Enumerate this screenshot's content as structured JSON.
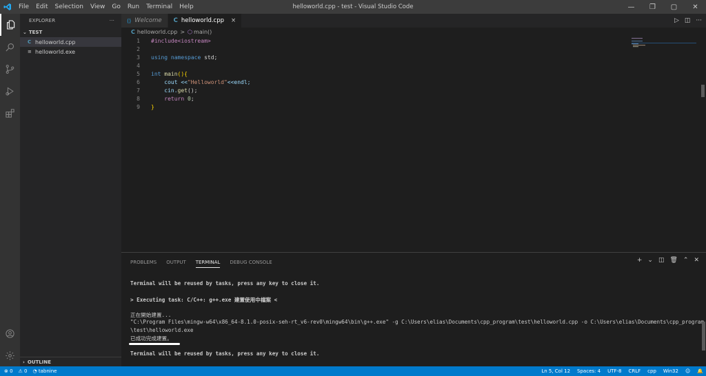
{
  "window": {
    "title": "helloworld.cpp - test - Visual Studio Code",
    "menu": [
      "File",
      "Edit",
      "Selection",
      "View",
      "Go",
      "Run",
      "Terminal",
      "Help"
    ],
    "controls": [
      "—",
      "❐",
      "▢",
      "✕"
    ]
  },
  "sidebar": {
    "header": "EXPLORER",
    "more": "···",
    "section": "TEST",
    "files": [
      {
        "name": "helloworld.cpp",
        "icon": "C"
      },
      {
        "name": "helloworld.exe",
        "icon": "≡"
      }
    ],
    "outline": "OUTLINE"
  },
  "tabs": [
    {
      "label": "Welcome"
    },
    {
      "label": "helloworld.cpp",
      "close": "×"
    }
  ],
  "tab_actions": [
    "▷",
    "◫",
    "···"
  ],
  "breadcrumb": {
    "file": "helloworld.cpp",
    "sep": ">",
    "symbol": "main()"
  },
  "editor": {
    "line_numbers": [
      "1",
      "2",
      "3",
      "4",
      "5",
      "6",
      "7",
      "8",
      "9"
    ],
    "lines": {
      "l1": "#include<iostream>",
      "l3a": "using",
      "l3b": "namespace",
      "l3c": "std;",
      "l5a": "int",
      "l5b": "main",
      "l5c": "(){",
      "l6a": "cout <<",
      "l6b": "\"Helloworld\"",
      "l6c": "<<endl;",
      "l7a": "cin.",
      "l7b": "get",
      "l7c": "();",
      "l8a": "return",
      "l8b": "0",
      "l8c": ";",
      "l9": "}"
    }
  },
  "panel": {
    "tabs": [
      "PROBLEMS",
      "OUTPUT",
      "TERMINAL",
      "DEBUG CONSOLE"
    ],
    "actions": [
      "+",
      "⌄",
      "◫",
      "🗑",
      "⌃",
      "✕"
    ],
    "terminal": [
      "Terminal will be reused by tasks, press any key to close it.",
      "",
      "> Executing task: C/C++: g++.exe 建置使用中檔案 <",
      "",
      "正在開始建置...",
      "\"C:\\Program Files\\mingw-w64\\x86_64-8.1.0-posix-seh-rt_v6-rev0\\mingw64\\bin\\g++.exe\" -g C:\\Users\\elias\\Documents\\cpp_program\\test\\helloworld.cpp -o C:\\Users\\elias\\Documents\\cpp_program",
      "\\test\\helloworld.exe",
      "已成功完成建置。",
      "",
      "Terminal will be reused by tasks, press any key to close it."
    ]
  },
  "statusbar": {
    "errors": "⊗ 0",
    "warnings": "⚠ 0",
    "tabnine": "tabnine",
    "position": "Ln 5, Col 12",
    "spaces": "Spaces: 4",
    "encoding": "UTF-8",
    "eol": "CRLF",
    "language": "cpp",
    "platform": "Win32"
  }
}
